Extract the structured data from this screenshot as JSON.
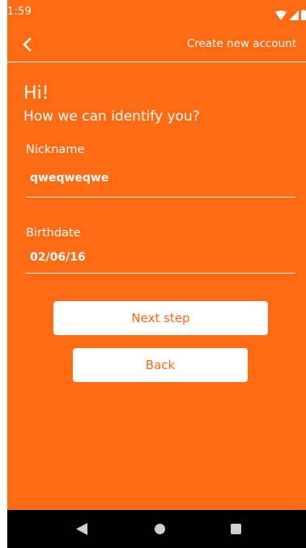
{
  "status_bar": {
    "time": "1:59",
    "wifi_icon": "wifi-icon",
    "signal_icon": "signal-icon",
    "battery_icon": "battery-icon"
  },
  "app_bar": {
    "back_icon": "chevron-left-icon",
    "title": "Create new account"
  },
  "form": {
    "greeting": "Hi!",
    "subtitle": "How we can identify you?",
    "nickname_label": "Nickname",
    "nickname_value": "qweqweqwe",
    "birthdate_label": "Birthdate",
    "birthdate_value": "02/06/16"
  },
  "buttons": {
    "next_label": "Next step",
    "back_label": "Back"
  },
  "nav_bar": {
    "back_icon": "triangle-back-icon",
    "home_icon": "circle-home-icon",
    "recents_icon": "square-recents-icon"
  },
  "colors": {
    "accent": "#ff6a13",
    "nav_background": "#000000",
    "button_background": "#ffffff"
  }
}
